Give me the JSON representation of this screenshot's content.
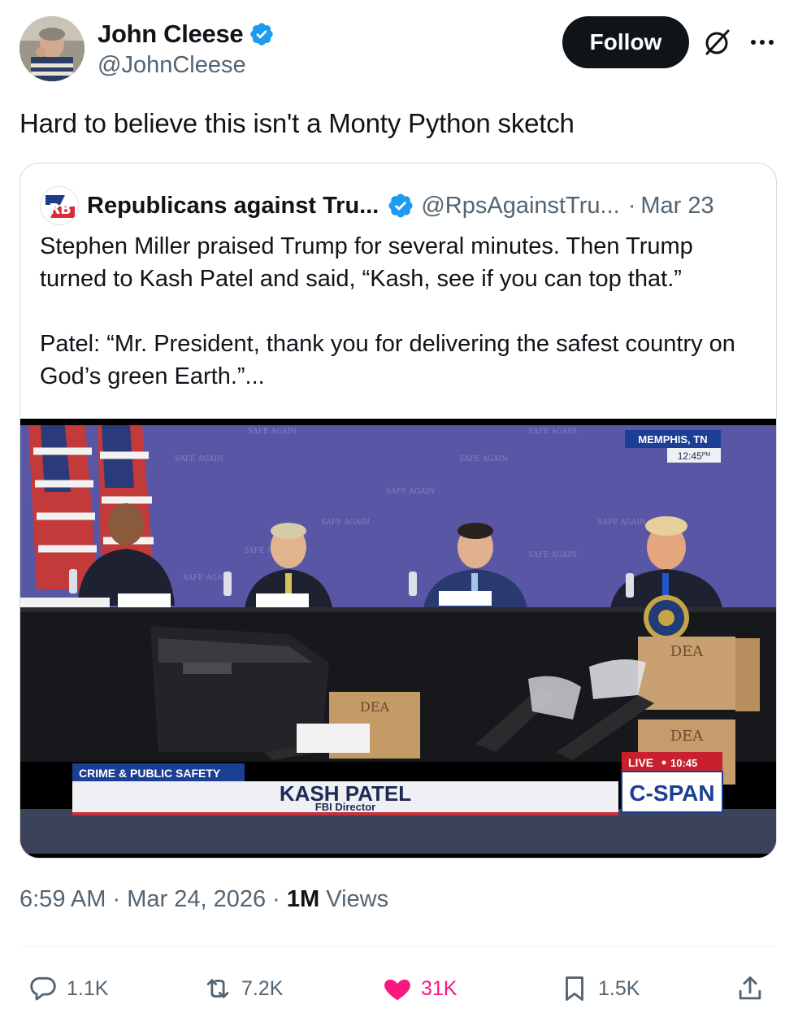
{
  "author": {
    "display_name": "John Cleese",
    "handle": "@JohnCleese",
    "verified": true
  },
  "follow_label": "Follow",
  "tweet_text": "Hard to believe this isn't a Monty Python sketch",
  "quoted": {
    "avatar_text": "RB",
    "display_name": "Republicans against Tru...",
    "handle": "@RpsAgainstTru...",
    "separator": "·",
    "date": "Mar 23",
    "paragraph1": "Stephen Miller praised Trump for several minutes. Then Trump turned to Kash Patel and said, “Kash, see if you can top that.”",
    "paragraph2": "Patel: “Mr. President, thank you for delivering the safest country on God’s green Earth.”...",
    "video": {
      "location_label": "MEMPHIS, TN",
      "location_time": "12:45",
      "time_suffix": "PM",
      "topic_label": "CRIME & PUBLIC SAFETY",
      "speaker_name": "KASH PATEL",
      "speaker_title": "FBI Director",
      "live_label": "LIVE",
      "live_time": "10:45",
      "network": "C-SPAN",
      "backdrop_text": "SAFE AGAIN",
      "box_label": "DEA"
    }
  },
  "meta": {
    "time": "6:59 AM",
    "sep1": "·",
    "date": "Mar 24, 2026",
    "sep2": "·",
    "views_count": "1M",
    "views_label": "Views"
  },
  "actions": {
    "replies": "1.1K",
    "reposts": "7.2K",
    "likes": "31K",
    "bookmarks": "1.5K"
  },
  "colors": {
    "accent_blue": "#1d9bf0",
    "like_pink": "#f91880",
    "text_primary": "#0f1419",
    "text_secondary": "#536471",
    "border": "#cfd9de",
    "backdrop_purple": "#5a56a6"
  }
}
